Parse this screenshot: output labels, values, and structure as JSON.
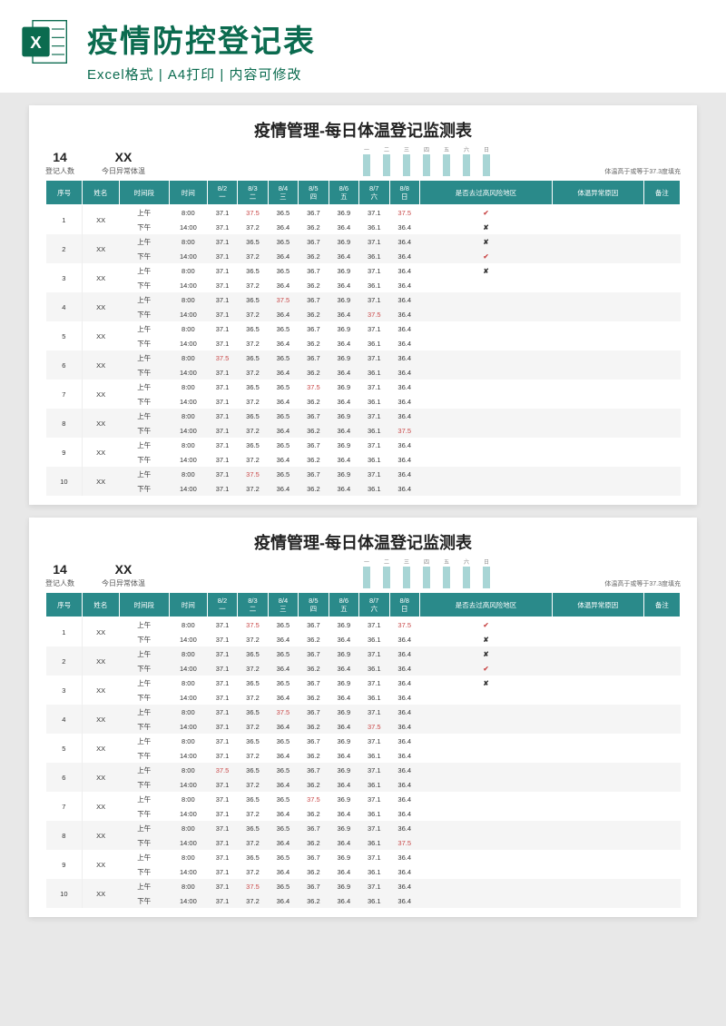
{
  "banner": {
    "title": "疫情防控登记表",
    "subtitle": "Excel格式 | A4打印 | 内容可修改"
  },
  "sheet": {
    "title": "疫情管理-每日体温登记监测表",
    "summary": {
      "count_val": "14",
      "count_lbl": "登记人数",
      "abnormal_val": "XX",
      "abnormal_lbl": "今日异常体温"
    },
    "week_labels": [
      "一",
      "二",
      "三",
      "四",
      "五",
      "六",
      "日"
    ],
    "threshold_note": "体温高于或等于37.3度填充",
    "headers": {
      "seq": "序号",
      "name": "姓名",
      "period": "时间段",
      "time": "时间",
      "risk": "是否去过高风险地区",
      "reason": "体温异常原因",
      "remark": "备注"
    },
    "date_headers": [
      {
        "d": "8/2",
        "w": "一"
      },
      {
        "d": "8/3",
        "w": "二"
      },
      {
        "d": "8/4",
        "w": "三"
      },
      {
        "d": "8/5",
        "w": "四"
      },
      {
        "d": "8/6",
        "w": "五"
      },
      {
        "d": "8/7",
        "w": "六"
      },
      {
        "d": "8/8",
        "w": "日"
      }
    ],
    "period": {
      "am": "上午",
      "pm": "下午"
    },
    "times": {
      "am": "8:00",
      "pm": "14:00"
    },
    "name_placeholder": "XX",
    "rows": [
      {
        "seq": "1",
        "am": [
          "37.1",
          "37.5",
          "36.5",
          "36.7",
          "36.9",
          "37.1",
          "37.5"
        ],
        "pm": [
          "37.1",
          "37.2",
          "36.4",
          "36.2",
          "36.4",
          "36.1",
          "36.4"
        ],
        "risk_am": "✔",
        "risk_pm": "✘"
      },
      {
        "seq": "2",
        "am": [
          "37.1",
          "36.5",
          "36.5",
          "36.7",
          "36.9",
          "37.1",
          "36.4"
        ],
        "pm": [
          "37.1",
          "37.2",
          "36.4",
          "36.2",
          "36.4",
          "36.1",
          "36.4"
        ],
        "risk_am": "✘",
        "risk_pm": "✔"
      },
      {
        "seq": "3",
        "am": [
          "37.1",
          "36.5",
          "36.5",
          "36.7",
          "36.9",
          "37.1",
          "36.4"
        ],
        "pm": [
          "37.1",
          "37.2",
          "36.4",
          "36.2",
          "36.4",
          "36.1",
          "36.4"
        ],
        "risk_am": "✘",
        "risk_pm": ""
      },
      {
        "seq": "4",
        "am": [
          "37.1",
          "36.5",
          "37.5",
          "36.7",
          "36.9",
          "37.1",
          "36.4"
        ],
        "pm": [
          "37.1",
          "37.2",
          "36.4",
          "36.2",
          "36.4",
          "37.5",
          "36.4"
        ],
        "risk_am": "",
        "risk_pm": ""
      },
      {
        "seq": "5",
        "am": [
          "37.1",
          "36.5",
          "36.5",
          "36.7",
          "36.9",
          "37.1",
          "36.4"
        ],
        "pm": [
          "37.1",
          "37.2",
          "36.4",
          "36.2",
          "36.4",
          "36.1",
          "36.4"
        ],
        "risk_am": "",
        "risk_pm": ""
      },
      {
        "seq": "6",
        "am": [
          "37.5",
          "36.5",
          "36.5",
          "36.7",
          "36.9",
          "37.1",
          "36.4"
        ],
        "pm": [
          "37.1",
          "37.2",
          "36.4",
          "36.2",
          "36.4",
          "36.1",
          "36.4"
        ],
        "risk_am": "",
        "risk_pm": ""
      },
      {
        "seq": "7",
        "am": [
          "37.1",
          "36.5",
          "36.5",
          "37.5",
          "36.9",
          "37.1",
          "36.4"
        ],
        "pm": [
          "37.1",
          "37.2",
          "36.4",
          "36.2",
          "36.4",
          "36.1",
          "36.4"
        ],
        "risk_am": "",
        "risk_pm": ""
      },
      {
        "seq": "8",
        "am": [
          "37.1",
          "36.5",
          "36.5",
          "36.7",
          "36.9",
          "37.1",
          "36.4"
        ],
        "pm": [
          "37.1",
          "37.2",
          "36.4",
          "36.2",
          "36.4",
          "36.1",
          "37.5"
        ],
        "risk_am": "",
        "risk_pm": ""
      },
      {
        "seq": "9",
        "am": [
          "37.1",
          "36.5",
          "36.5",
          "36.7",
          "36.9",
          "37.1",
          "36.4"
        ],
        "pm": [
          "37.1",
          "37.2",
          "36.4",
          "36.2",
          "36.4",
          "36.1",
          "36.4"
        ],
        "risk_am": "",
        "risk_pm": ""
      },
      {
        "seq": "10",
        "am": [
          "37.1",
          "37.5",
          "36.5",
          "36.7",
          "36.9",
          "37.1",
          "36.4"
        ],
        "pm": [
          "37.1",
          "37.2",
          "36.4",
          "36.2",
          "36.4",
          "36.1",
          "36.4"
        ],
        "risk_am": "",
        "risk_pm": ""
      }
    ]
  },
  "chart_data": {
    "type": "bar",
    "categories": [
      "一",
      "二",
      "三",
      "四",
      "五",
      "六",
      "日"
    ],
    "values": [
      14,
      14,
      14,
      14,
      14,
      14,
      14
    ],
    "title": "",
    "xlabel": "",
    "ylabel": "",
    "ylim": [
      0,
      14
    ]
  },
  "threshold": 37.3
}
